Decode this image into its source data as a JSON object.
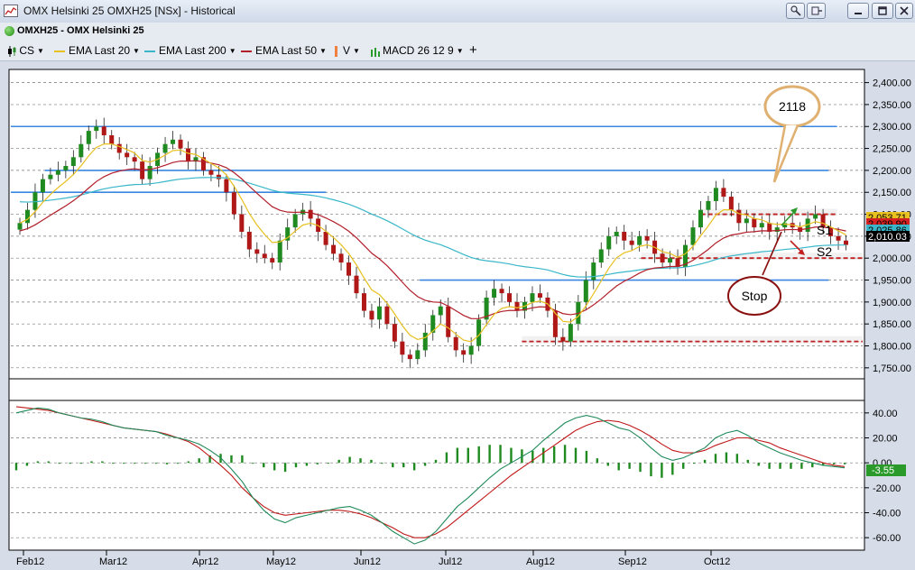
{
  "window": {
    "title": "OMX Helsinki 25 OMXH25 [NSx] - Historical",
    "icon": "chart-icon",
    "buttons": {
      "crosshair_icon": "crosshair-icon",
      "pin_icon": "pin-icon",
      "minimize_icon": "minimize-icon",
      "maximize_icon": "maximize-icon",
      "close_icon": "close-icon"
    }
  },
  "symbol_bar": {
    "label": "OMXH25 - OMX Helsinki 25",
    "status_color": "#2aa516"
  },
  "toolbar": {
    "items": [
      {
        "label": "CS",
        "color": "#000000"
      },
      {
        "label": "EMA  Last 20",
        "color": "#e8c020"
      },
      {
        "label": "EMA  Last 200",
        "color": "#39b7c9"
      },
      {
        "label": "EMA  Last 50",
        "color": "#b21e2a"
      },
      {
        "label": "V",
        "color": "#f08040"
      },
      {
        "label": "MACD  26 12 9",
        "color": "#2a9a2a"
      }
    ],
    "add_label": "+"
  },
  "chart_data": [
    {
      "type": "candlestick",
      "title": "",
      "yaxis_ticks": [
        "2,400.00",
        "2,350.00",
        "2,300.00",
        "2,250.00",
        "2,200.00",
        "2,150.00",
        "2,100.00",
        "2,050.00",
        "2,000.00",
        "1,950.00",
        "1,900.00",
        "1,850.00",
        "1,800.00",
        "1,750.00"
      ],
      "ylim": [
        1725,
        2430
      ],
      "price_labels": [
        {
          "text": "2,053.71",
          "color": "#e8c020"
        },
        {
          "text": "2,039.90",
          "color": "#d42020"
        },
        {
          "text": "2,025.86",
          "color": "#39b7c9"
        },
        {
          "text": "2,010.03",
          "color": "#ffffff"
        }
      ],
      "series_close": [
        2080,
        2110,
        2150,
        2180,
        2190,
        2200,
        2210,
        2230,
        2260,
        2290,
        2300,
        2280,
        2260,
        2240,
        2230,
        2220,
        2180,
        2210,
        2240,
        2260,
        2270,
        2250,
        2220,
        2230,
        2200,
        2190,
        2180,
        2150,
        2100,
        2060,
        2020,
        2010,
        2000,
        1990,
        2040,
        2070,
        2100,
        2110,
        2090,
        2060,
        2030,
        2010,
        1990,
        1960,
        1920,
        1880,
        1860,
        1890,
        1850,
        1810,
        1780,
        1770,
        1790,
        1830,
        1870,
        1890,
        1820,
        1790,
        1780,
        1800,
        1860,
        1910,
        1930,
        1920,
        1900,
        1880,
        1900,
        1920,
        1910,
        1880,
        1820,
        1810,
        1850,
        1900,
        1950,
        1990,
        2020,
        2050,
        2060,
        2040,
        2030,
        2050,
        2040,
        2010,
        1990,
        2000,
        1980,
        2030,
        2070,
        2110,
        2130,
        2160,
        2140,
        2110,
        2080,
        2090,
        2070,
        2080,
        2060,
        2070,
        2080,
        2070,
        2060,
        2090,
        2100,
        2070,
        2050,
        2040,
        2030
      ],
      "horizontal_levels": [
        2300,
        2200,
        2150,
        1950
      ],
      "dashed_levels": [
        2100,
        2000,
        1810
      ],
      "annotations": [
        {
          "text": "2118",
          "shape": "callout"
        },
        {
          "text": "S1"
        },
        {
          "text": "S2"
        },
        {
          "text": "Stop",
          "shape": "callout"
        }
      ],
      "xaxis_labels": [
        "Feb12",
        "Mar12",
        "Apr12",
        "May12",
        "Jun12",
        "Jul12",
        "Aug12",
        "Sep12",
        "Oct12"
      ]
    },
    {
      "type": "line",
      "title": "",
      "name": "MACD",
      "yaxis_ticks": [
        "40.00",
        "20.00",
        "0.00",
        "-20.00",
        "-40.00",
        "-60.00"
      ],
      "ylim": [
        -70,
        50
      ],
      "current_value": "-3.55",
      "macd": [
        40,
        42,
        44,
        43,
        40,
        38,
        36,
        35,
        33,
        30,
        28,
        27,
        26,
        25,
        22,
        20,
        18,
        15,
        10,
        4,
        -5,
        -15,
        -28,
        -38,
        -45,
        -48,
        -44,
        -42,
        -40,
        -38,
        -36,
        -35,
        -38,
        -42,
        -48,
        -55,
        -60,
        -65,
        -62,
        -55,
        -45,
        -35,
        -28,
        -20,
        -12,
        -5,
        0,
        5,
        10,
        18,
        25,
        32,
        36,
        38,
        36,
        32,
        28,
        26,
        20,
        12,
        5,
        2,
        4,
        8,
        12,
        20,
        24,
        26,
        22,
        16,
        12,
        8,
        5,
        2,
        0,
        -2,
        -3,
        -4
      ],
      "signal": [
        45,
        44,
        43,
        42,
        40,
        38,
        36,
        34,
        32,
        30,
        28,
        27,
        26,
        25,
        23,
        20,
        17,
        12,
        5,
        -2,
        -10,
        -20,
        -28,
        -35,
        -40,
        -42,
        -41,
        -40,
        -39,
        -38,
        -38,
        -39,
        -41,
        -44,
        -48,
        -52,
        -57,
        -60,
        -60,
        -57,
        -52,
        -45,
        -38,
        -31,
        -24,
        -17,
        -10,
        -4,
        2,
        8,
        14,
        20,
        26,
        30,
        33,
        34,
        33,
        30,
        26,
        21,
        15,
        10,
        8,
        8,
        10,
        14,
        17,
        20,
        20,
        18,
        16,
        12,
        9,
        6,
        3,
        0,
        -2,
        -3
      ]
    }
  ]
}
